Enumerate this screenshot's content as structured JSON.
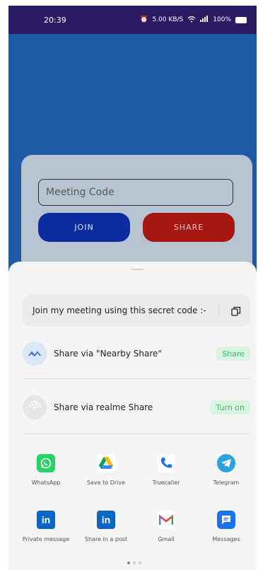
{
  "status_bar": {
    "time": "20:39",
    "net_speed": "5.00 KB/S",
    "battery_text": "100%"
  },
  "meeting_form": {
    "code_placeholder": "Meeting Code",
    "join_label": "JOIN",
    "share_label": "SHARE"
  },
  "share_sheet": {
    "message": "Join my meeting using this secret code :-",
    "nearby": {
      "label": "Share via \"Nearby Share\"",
      "action": "Share"
    },
    "realme": {
      "label": "Share via realme Share",
      "action": "Turn on"
    },
    "apps": [
      {
        "name": "WhatsApp",
        "icon": "whatsapp-icon",
        "color": "#25d366"
      },
      {
        "name": "Save to Drive",
        "icon": "drive-icon",
        "color": "#fbbc04"
      },
      {
        "name": "Truecaller",
        "icon": "phone-icon",
        "color": "#1a73e8"
      },
      {
        "name": "Telegram",
        "icon": "telegram-icon",
        "color": "#2aa3dc"
      },
      {
        "name": "Private message",
        "icon": "linkedin-icon",
        "color": "#0a66c2"
      },
      {
        "name": "Share in a post",
        "icon": "linkedin-icon",
        "color": "#0a66c2"
      },
      {
        "name": "Gmail",
        "icon": "gmail-icon",
        "color": "#ea4335"
      },
      {
        "name": "Messages",
        "icon": "messages-icon",
        "color": "#1a73e8"
      }
    ],
    "page_count": 3,
    "active_page": 1
  },
  "colors": {
    "status_bar": "#2b1b63",
    "app_background": "#1f5aa6",
    "join_button": "#0d2a9e",
    "share_button": "#a51710",
    "action_pill_text": "#3ab86b"
  }
}
